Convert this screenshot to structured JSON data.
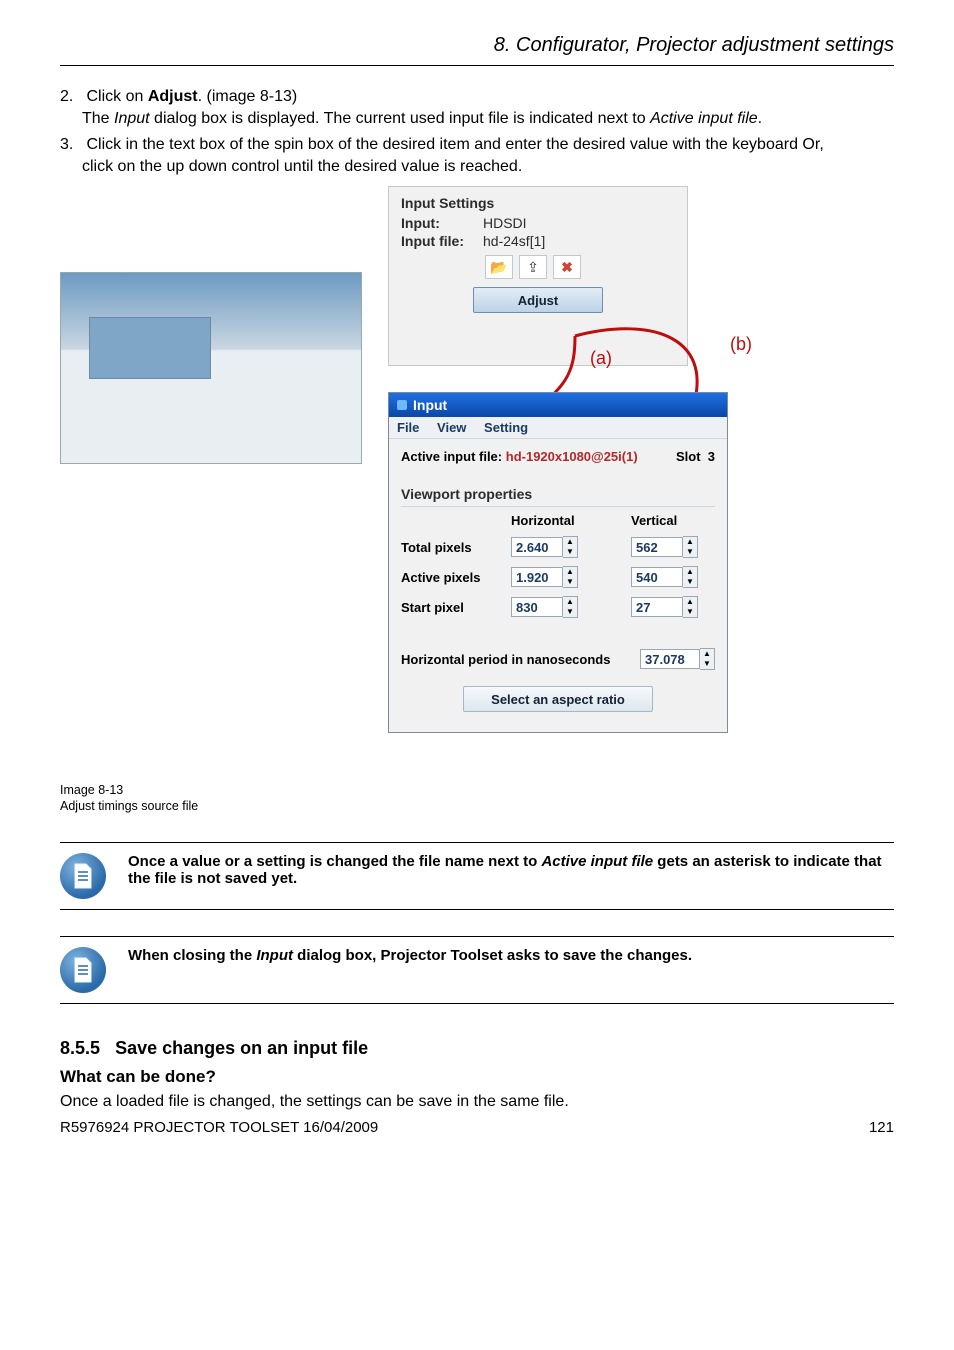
{
  "running_head": "8.  Configurator, Projector adjustment settings",
  "steps": {
    "s2_num": "2.",
    "s2_text_a": "Click on ",
    "s2_bold": "Adjust",
    "s2_text_b": ".  (image 8-13)",
    "s2_sub_a": "The ",
    "s2_sub_i1": "Input",
    "s2_sub_b": " dialog box is displayed.  The current used input file is indicated next to ",
    "s2_sub_i2": "Active input file",
    "s2_sub_c": ".",
    "s3_num": "3.",
    "s3_text": "Click in the text box of the spin box of the desired item and enter the desired value with the keyboard Or,",
    "s3_sub": "click on the up down control until the desired value is reached."
  },
  "input_settings": {
    "title": "Input Settings",
    "input_lab": "Input:",
    "input_val": "HDSDI",
    "file_lab": "Input file:",
    "file_val": "hd-24sf[1]",
    "open_icon": "📂",
    "save_icon": "⇪",
    "close_icon": "✖",
    "adjust_label": "Adjust",
    "callout_a": "(a)",
    "callout_b": "(b)"
  },
  "input_window": {
    "title": "Input",
    "menu": {
      "file": "File",
      "view": "View",
      "setting": "Setting"
    },
    "active_label": "Active input file:",
    "active_file": "hd-1920x1080@25i(1)",
    "slot_label": "Slot",
    "slot_value": "3",
    "group": "Viewport properties",
    "head_h": "Horizontal",
    "head_v": "Vertical",
    "rows": {
      "total": {
        "label": "Total pixels",
        "h": "2.640",
        "v": "562"
      },
      "active": {
        "label": "Active pixels",
        "h": "1.920",
        "v": "540"
      },
      "start": {
        "label": "Start pixel",
        "h": "830",
        "v": "27"
      }
    },
    "hp_label": "Horizontal period in nanoseconds",
    "hp_value": "37.078",
    "aspect_label": "Select an aspect ratio"
  },
  "caption": {
    "l1": "Image 8-13",
    "l2": "Adjust timings source file"
  },
  "note1_a": "Once a value or a setting is changed the file name next to ",
  "note1_i": "Active input file",
  "note1_b": " gets an asterisk to indicate that the file is not saved yet.",
  "note2_a": "When closing the ",
  "note2_i": "Input",
  "note2_b": " dialog box, Projector Toolset asks to save the changes.",
  "section_num": "8.5.5",
  "section_title": "Save changes on an input file",
  "subheading": "What can be done?",
  "body_text": "Once a loaded file is changed, the settings can be save in the same file.",
  "footer_left": "R5976924   PROJECTOR TOOLSET   16/04/2009",
  "footer_right": "121"
}
